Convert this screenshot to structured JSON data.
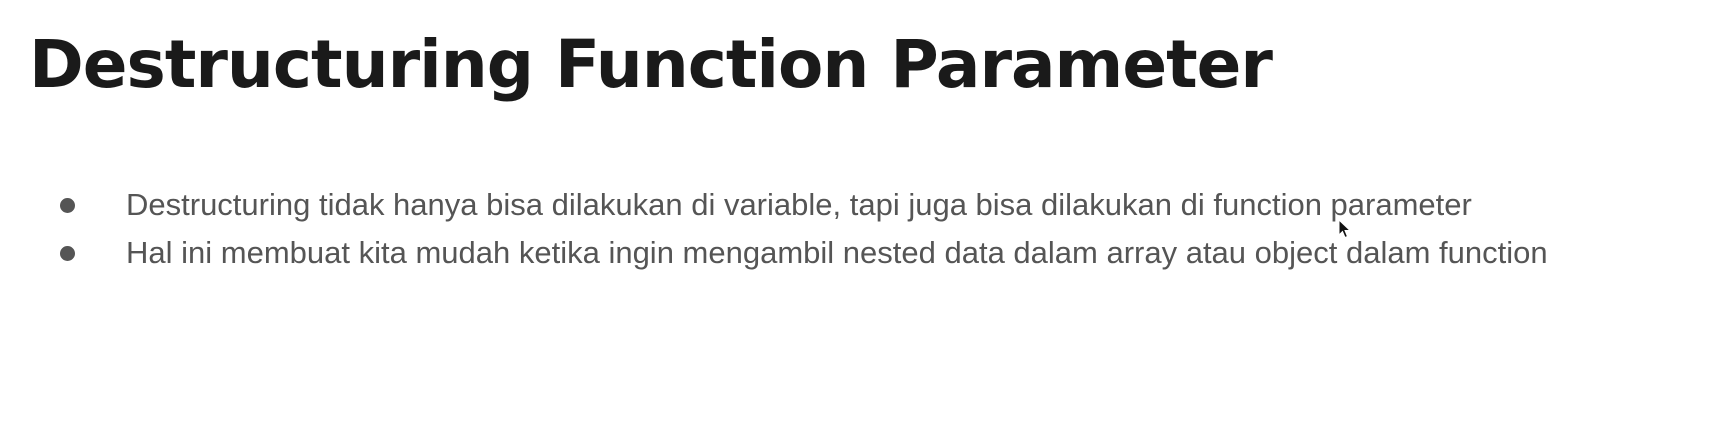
{
  "slide": {
    "title": "Destructuring Function Parameter",
    "bullets": [
      {
        "text": "Destructuring tidak hanya bisa dilakukan di variable, tapi juga bisa dilakukan di function parameter"
      },
      {
        "text": "Hal ini membuat kita mudah ketika ingin mengambil nested data dalam array atau object dalam function"
      }
    ]
  },
  "colors": {
    "title": "#1a1a1a",
    "body_text": "#555555",
    "background": "#ffffff"
  },
  "icons": {
    "cursor": "mouse-pointer-icon",
    "bullet": "bullet-dot-icon"
  }
}
